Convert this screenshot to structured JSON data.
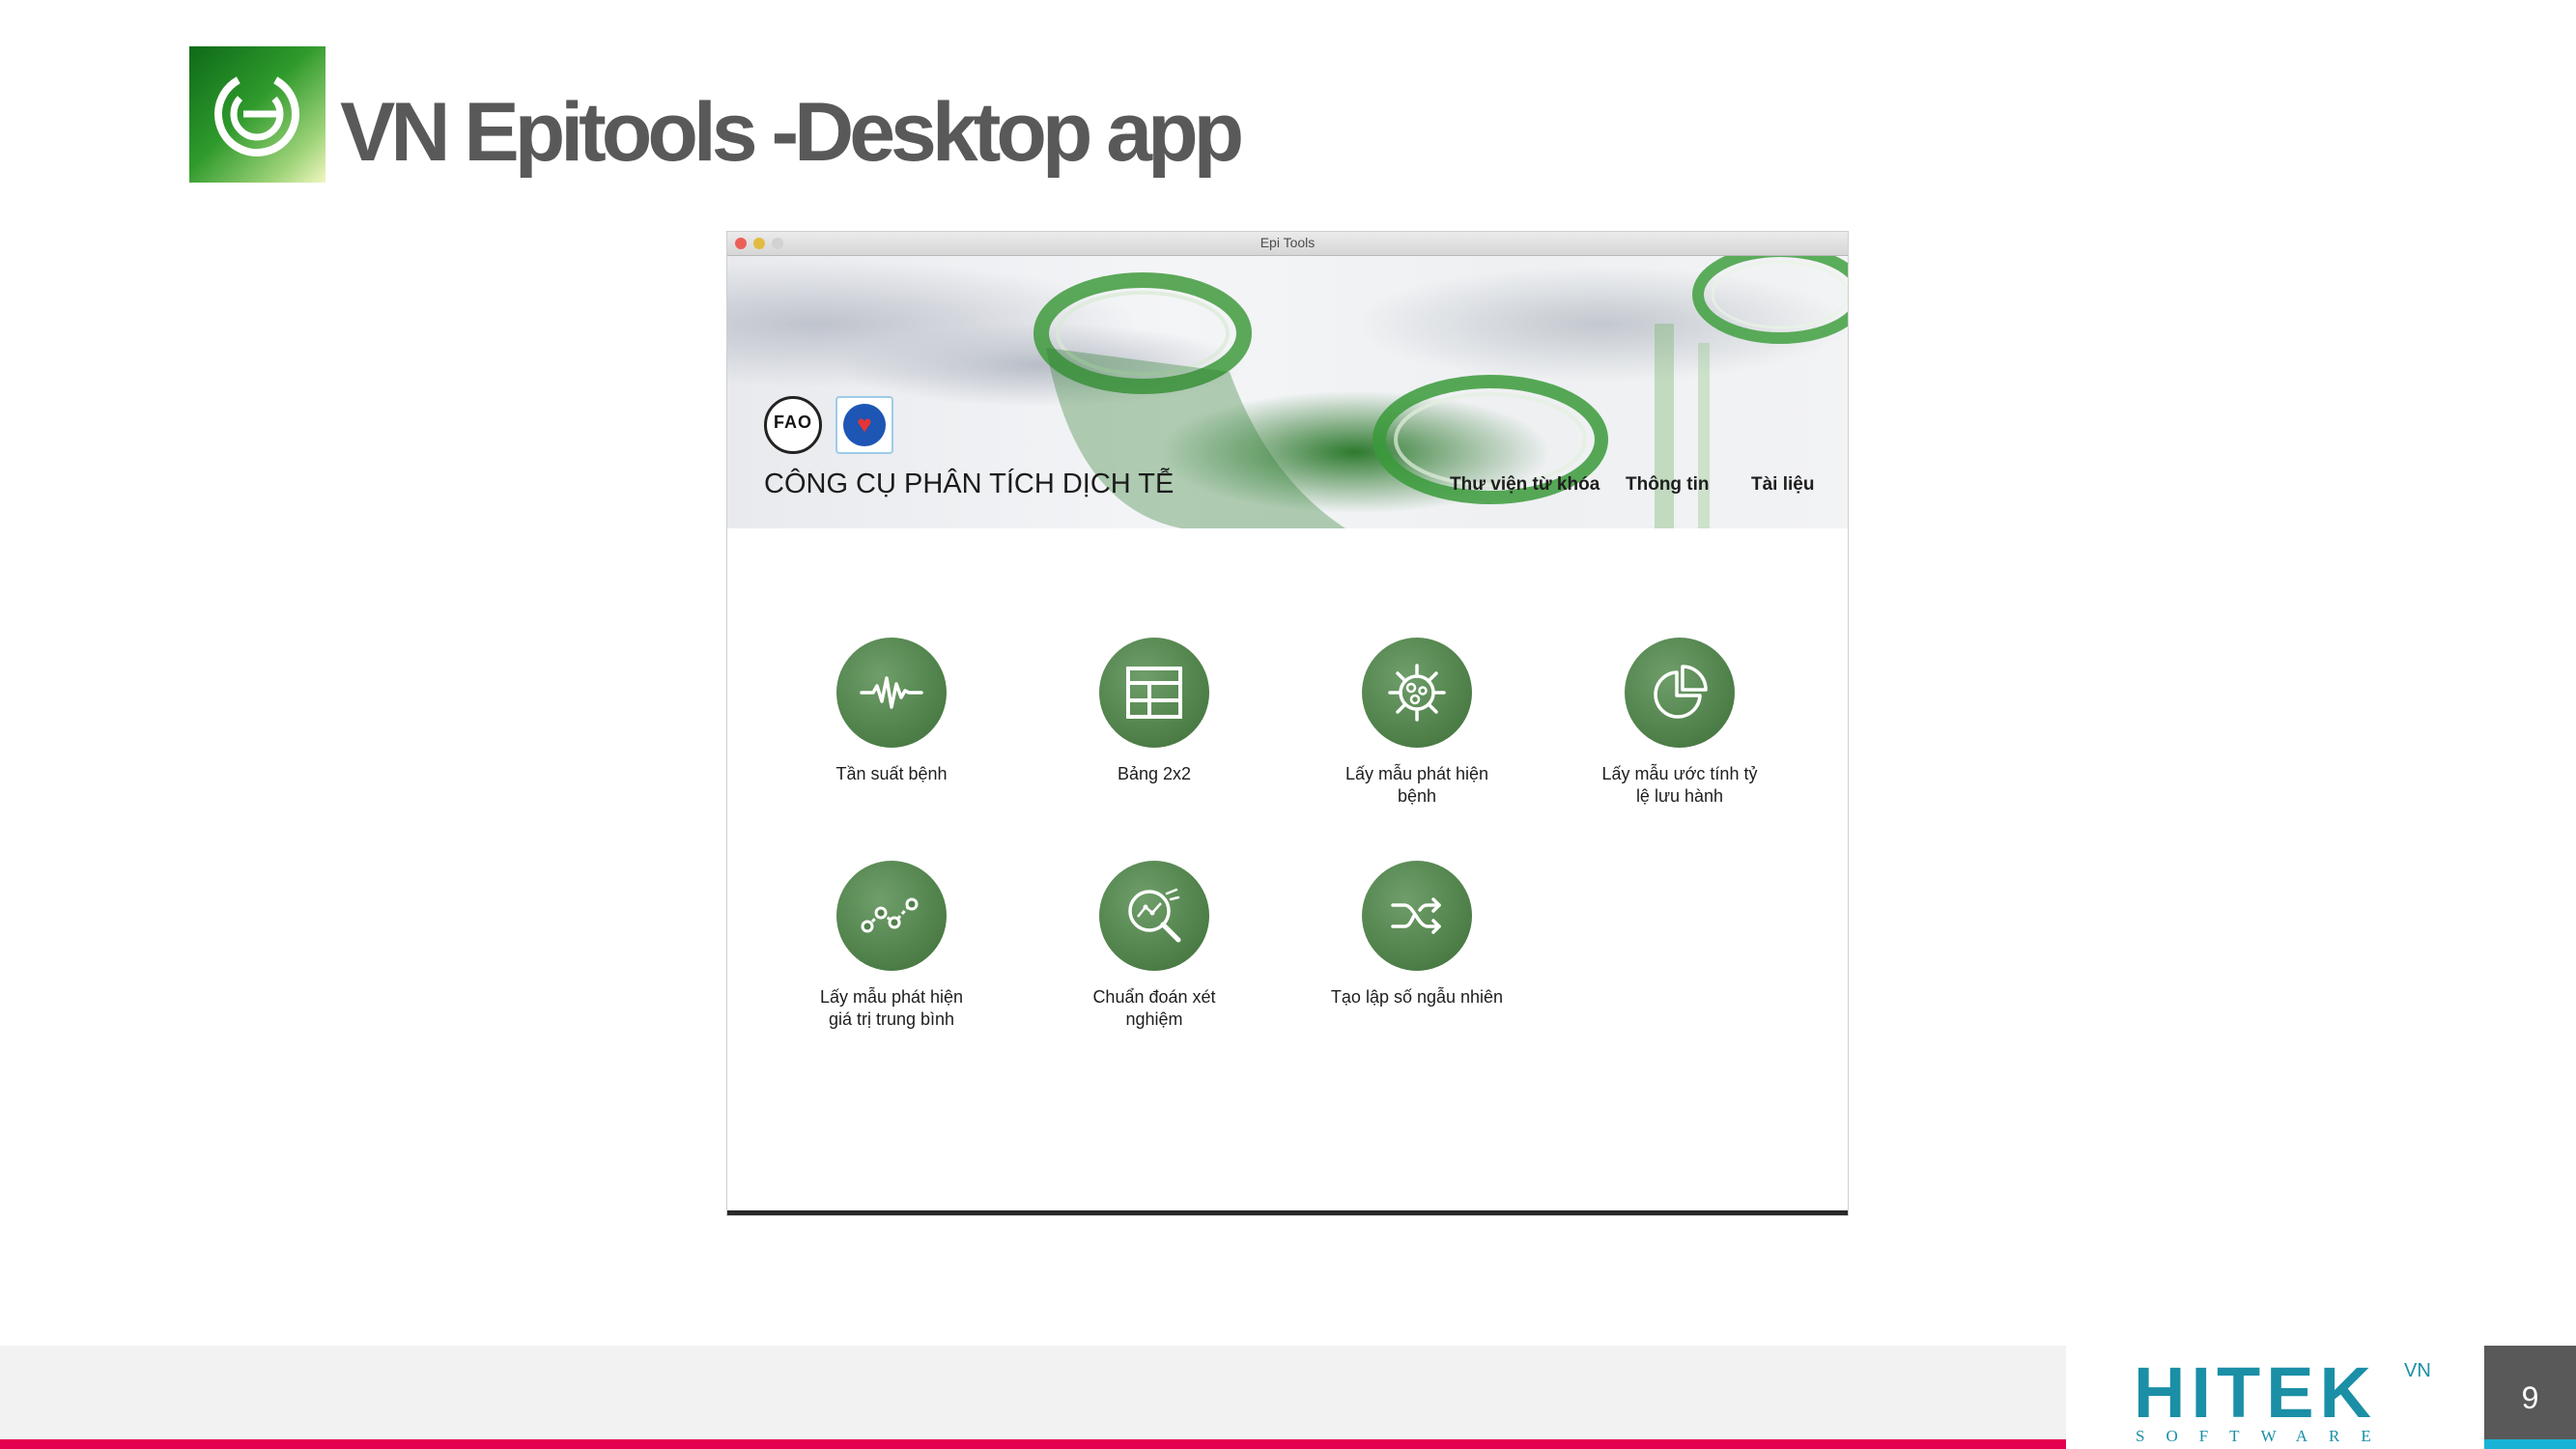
{
  "slide": {
    "title": "VN Epitools -Desktop app",
    "page_number": "9"
  },
  "window": {
    "title": "Epi Tools",
    "banner": {
      "title": "CÔNG CỤ PHÂN TÍCH DỊCH TỄ",
      "nav": [
        "Thư viện từ khóa",
        "Thông tin",
        "Tài liệu"
      ],
      "fao_logo_text": "FAO"
    },
    "tools": [
      {
        "label": "Tần suất bệnh",
        "icon": "waveform-icon"
      },
      {
        "label": "Bảng 2x2",
        "icon": "table-grid-icon"
      },
      {
        "label": "Lấy mẫu phát hiện\nbệnh",
        "icon": "virus-icon"
      },
      {
        "label": "Lấy mẫu ước tính tỷ\nlệ lưu hành",
        "icon": "pie-chart-icon"
      },
      {
        "label": "Lấy mẫu phát hiện\ngiá trị trung bình",
        "icon": "line-graph-icon"
      },
      {
        "label": "Chuẩn đoán xét\nnghiệm",
        "icon": "magnifier-chart-icon"
      },
      {
        "label": "Tạo lập số ngẫu nhiên",
        "icon": "shuffle-icon"
      }
    ]
  },
  "footer": {
    "logo_text": "HITEK",
    "logo_sub": "SOFTWARE",
    "logo_sup": "VN"
  },
  "colors": {
    "accent_green": "#4f8049",
    "footer_red": "#e4004f",
    "hitek_teal": "#1a8fa6"
  }
}
